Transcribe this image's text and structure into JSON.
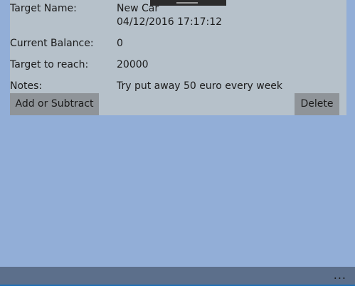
{
  "target": {
    "name_label": "Target Name:",
    "name_value": "New Car",
    "date_value": "04/12/2016 17:17:12",
    "balance_label": "Current Balance:",
    "balance_value": "0",
    "reach_label": "Target to reach:",
    "reach_value": "20000",
    "notes_label": "Notes:",
    "notes_value": "Try put away 50 euro every week"
  },
  "actions": {
    "add_subtract_label": "Add or Subtract",
    "delete_label": "Delete"
  },
  "appbar": {
    "more_label": "..."
  },
  "colors": {
    "page_background": "#92aed7",
    "card_background": "#b6c1ca",
    "button_background": "#8f9499",
    "appbar_background": "#5c6f8b"
  }
}
